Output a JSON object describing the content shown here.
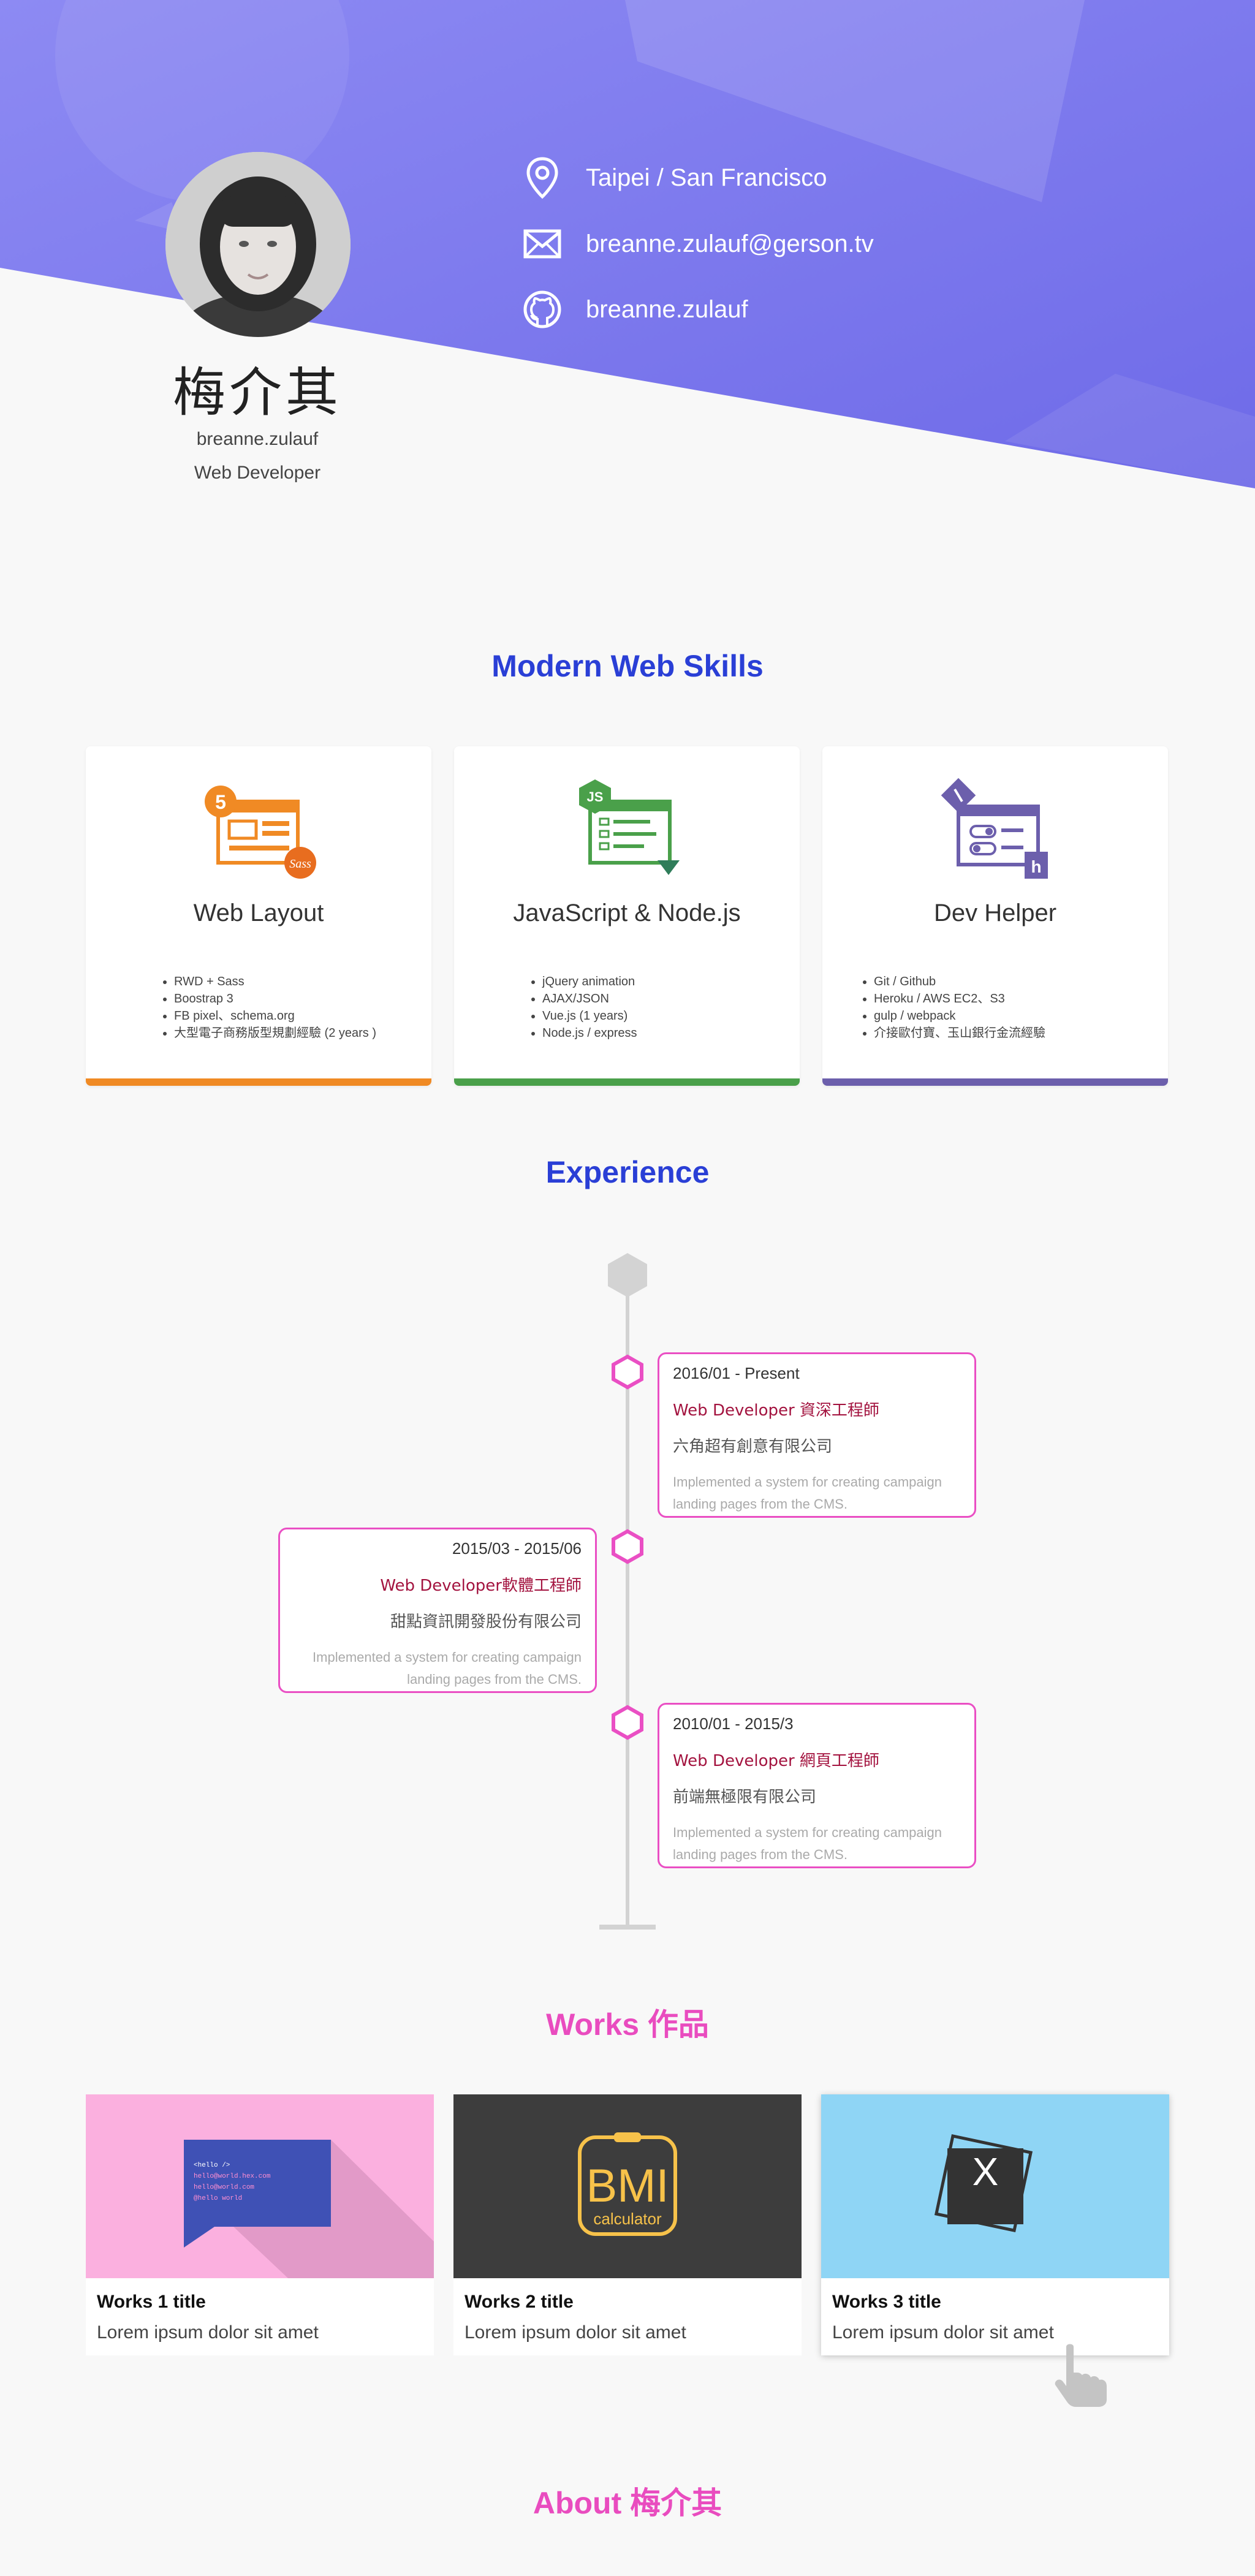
{
  "profile": {
    "name": "梅介其",
    "handle": "breanne.zulauf",
    "role": "Web Developer"
  },
  "contacts": [
    {
      "icon": "location-pin-icon",
      "text": "Taipei / San Francisco"
    },
    {
      "icon": "mail-icon",
      "text": "breanne.zulauf@gerson.tv"
    },
    {
      "icon": "github-icon",
      "text": "breanne.zulauf"
    }
  ],
  "skills": {
    "title": "Modern Web Skills",
    "cards": [
      {
        "title": "Web Layout",
        "accent": "#f08a24",
        "icon": "html5-sass-icon",
        "items": [
          "RWD + Sass",
          "Boostrap 3",
          "FB pixel、schema.org",
          "大型電子商務版型規劃經驗 (2 years )"
        ]
      },
      {
        "title": "JavaScript & Node.js",
        "accent": "#4aa04a",
        "icon": "javascript-icon",
        "items": [
          "jQuery animation",
          "AJAX/JSON",
          "Vue.js (1 years)",
          "Node.js / express"
        ]
      },
      {
        "title": "Dev Helper",
        "accent": "#6c5fac",
        "icon": "git-heroku-icon",
        "items": [
          "Git / Github",
          "Heroku / AWS EC2、S3",
          "gulp / webpack",
          "介接歐付寶、玉山銀行金流經驗"
        ]
      }
    ]
  },
  "experience": {
    "title": "Experience",
    "items": [
      {
        "date": "2016/01 - Present",
        "job": "Web Developer 資深工程師",
        "company": "六角超有創意有限公司",
        "desc1": "Implemented a system for creating campaign",
        "desc2": "landing pages from the CMS."
      },
      {
        "date": "2015/03 - 2015/06",
        "job": "Web Developer軟體工程師",
        "company": "甜點資訊開發股份有限公司",
        "desc1": "Implemented a system for creating campaign",
        "desc2": "landing pages from the CMS."
      },
      {
        "date": "2010/01 - 2015/3",
        "job": "Web Developer 網頁工程師",
        "company": "前端無極限有限公司",
        "desc1": "Implemented a system for creating campaign",
        "desc2": "landing pages from the CMS."
      }
    ]
  },
  "works": {
    "title": "Works 作品",
    "items": [
      {
        "title": "Works 1 title",
        "desc": "Lorem ipsum dolor sit amet",
        "bg": "#fbb0df",
        "code_lines": [
          "<hello />",
          "hello@world.hex.com",
          "hello@world.com",
          "@hello world"
        ]
      },
      {
        "title": "Works 2 title",
        "desc": "Lorem ipsum dolor sit amet",
        "bg": "#3d3d3d",
        "logo_main": "BMI",
        "logo_sub": "calculator"
      },
      {
        "title": "Works 3 title",
        "desc": "Lorem ipsum dolor sit amet",
        "bg": "#8fd5f5",
        "logo_main": "X"
      }
    ]
  },
  "about": {
    "title": "About 梅介其"
  }
}
